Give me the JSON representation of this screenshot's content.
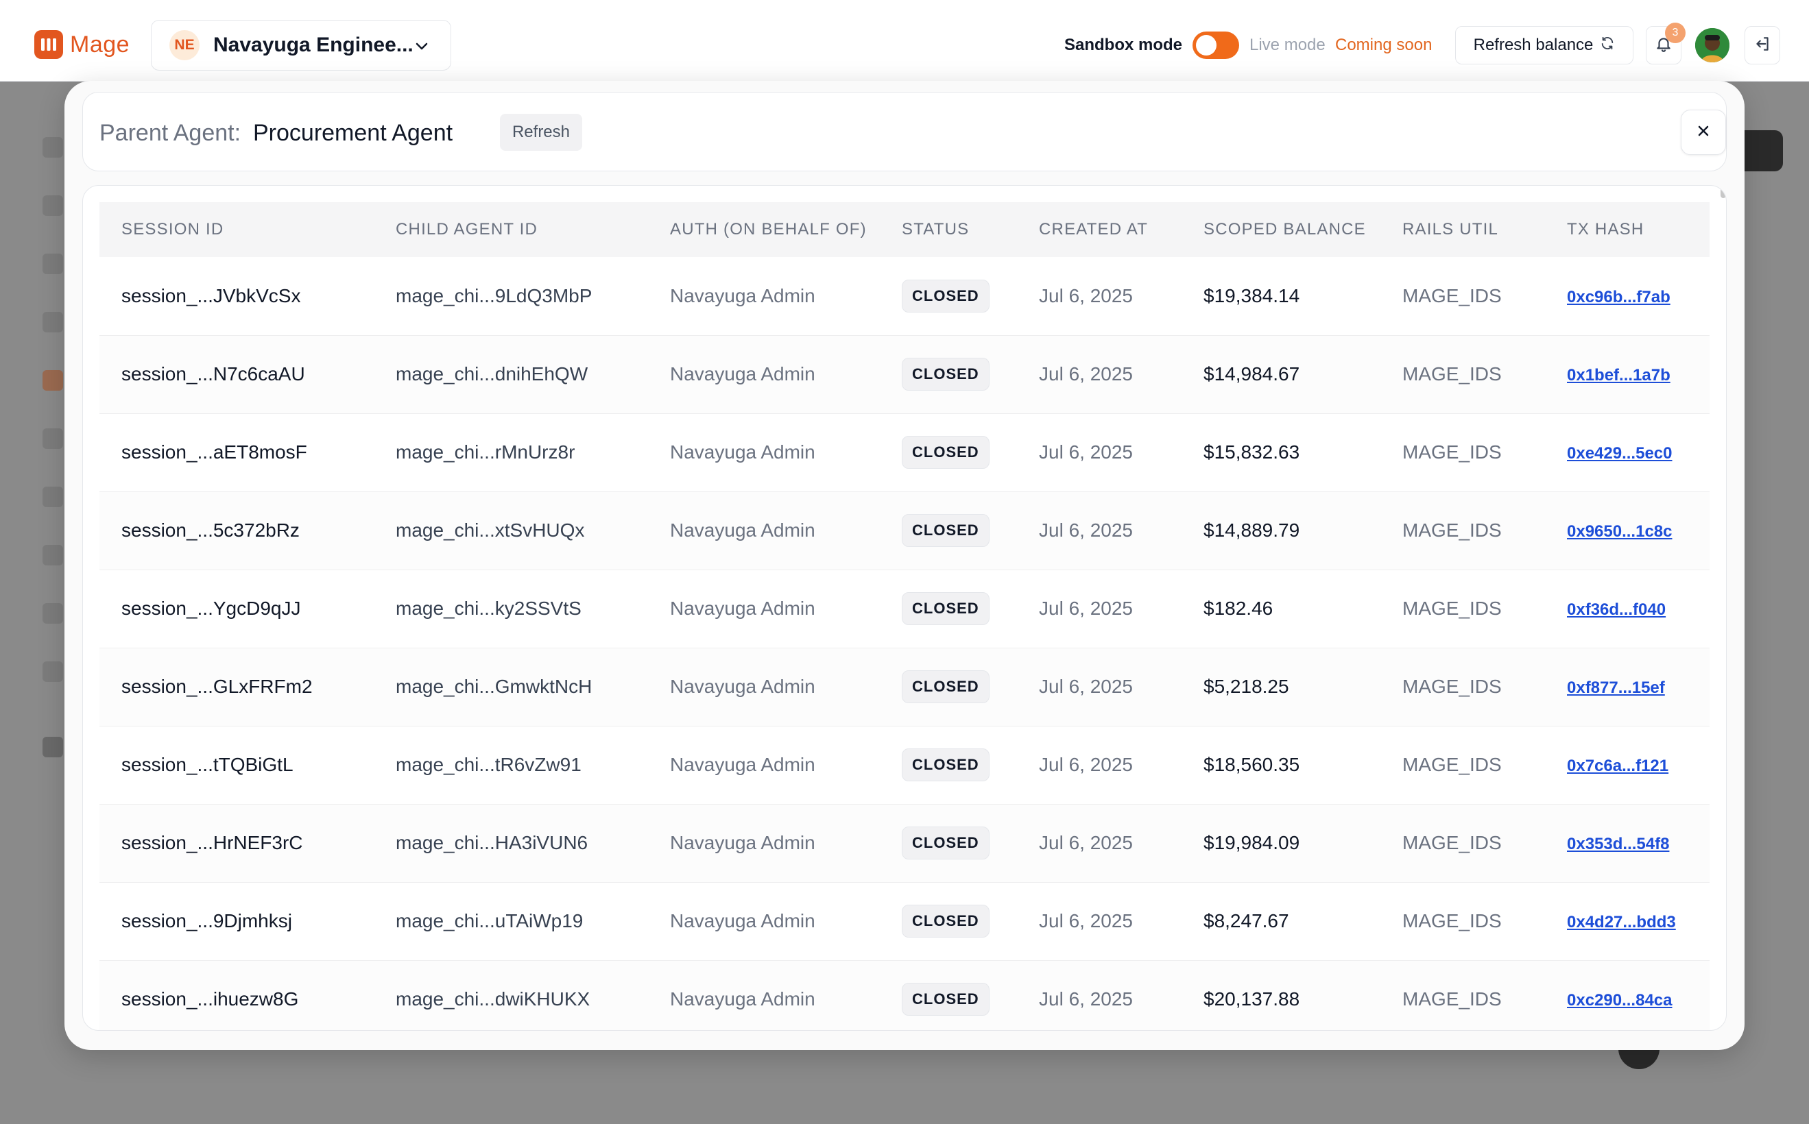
{
  "topbar": {
    "brand": "Mage",
    "org": {
      "initials": "NE",
      "name": "Navayuga Enginee..."
    },
    "sandbox_label": "Sandbox mode",
    "sandbox_on": true,
    "live_label": "Live mode",
    "coming_soon": "Coming soon",
    "refresh_balance": "Refresh balance",
    "notification_count": "3"
  },
  "modal": {
    "parent_label": "Parent Agent:",
    "parent_name": "Procurement Agent",
    "refresh_label": "Refresh",
    "columns": [
      "SESSION ID",
      "CHILD AGENT ID",
      "AUTH (ON BEHALF OF)",
      "STATUS",
      "CREATED AT",
      "SCOPED BALANCE",
      "RAILS UTIL",
      "TX HASH"
    ],
    "rows": [
      {
        "session": "session_...JVbkVcSx",
        "child": "mage_chi...9LdQ3MbP",
        "auth": "Navayuga Admin",
        "status": "CLOSED",
        "created": "Jul 6, 2025",
        "balance": "$19,384.14",
        "rails": "MAGE_IDS",
        "tx": "0xc96b...f7ab"
      },
      {
        "session": "session_...N7c6caAU",
        "child": "mage_chi...dnihEhQW",
        "auth": "Navayuga Admin",
        "status": "CLOSED",
        "created": "Jul 6, 2025",
        "balance": "$14,984.67",
        "rails": "MAGE_IDS",
        "tx": "0x1bef...1a7b"
      },
      {
        "session": "session_...aET8mosF",
        "child": "mage_chi...rMnUrz8r",
        "auth": "Navayuga Admin",
        "status": "CLOSED",
        "created": "Jul 6, 2025",
        "balance": "$15,832.63",
        "rails": "MAGE_IDS",
        "tx": "0xe429...5ec0"
      },
      {
        "session": "session_...5c372bRz",
        "child": "mage_chi...xtSvHUQx",
        "auth": "Navayuga Admin",
        "status": "CLOSED",
        "created": "Jul 6, 2025",
        "balance": "$14,889.79",
        "rails": "MAGE_IDS",
        "tx": "0x9650...1c8c"
      },
      {
        "session": "session_...YgcD9qJJ",
        "child": "mage_chi...ky2SSVtS",
        "auth": "Navayuga Admin",
        "status": "CLOSED",
        "created": "Jul 6, 2025",
        "balance": "$182.46",
        "rails": "MAGE_IDS",
        "tx": "0xf36d...f040"
      },
      {
        "session": "session_...GLxFRFm2",
        "child": "mage_chi...GmwktNcH",
        "auth": "Navayuga Admin",
        "status": "CLOSED",
        "created": "Jul 6, 2025",
        "balance": "$5,218.25",
        "rails": "MAGE_IDS",
        "tx": "0xf877...15ef"
      },
      {
        "session": "session_...tTQBiGtL",
        "child": "mage_chi...tR6vZw91",
        "auth": "Navayuga Admin",
        "status": "CLOSED",
        "created": "Jul 6, 2025",
        "balance": "$18,560.35",
        "rails": "MAGE_IDS",
        "tx": "0x7c6a...f121"
      },
      {
        "session": "session_...HrNEF3rC",
        "child": "mage_chi...HA3iVUN6",
        "auth": "Navayuga Admin",
        "status": "CLOSED",
        "created": "Jul 6, 2025",
        "balance": "$19,984.09",
        "rails": "MAGE_IDS",
        "tx": "0x353d...54f8"
      },
      {
        "session": "session_...9Djmhksj",
        "child": "mage_chi...uTAiWp19",
        "auth": "Navayuga Admin",
        "status": "CLOSED",
        "created": "Jul 6, 2025",
        "balance": "$8,247.67",
        "rails": "MAGE_IDS",
        "tx": "0x4d27...bdd3"
      },
      {
        "session": "session_...ihuezw8G",
        "child": "mage_chi...dwiKHUKX",
        "auth": "Navayuga Admin",
        "status": "CLOSED",
        "created": "Jul 6, 2025",
        "balance": "$20,137.88",
        "rails": "MAGE_IDS",
        "tx": "0xc290...84ca"
      }
    ]
  },
  "colors": {
    "brand": "#e2561f",
    "toggle_on": "#f06a1a",
    "link": "#1d4ed8",
    "overlay": "#8a8a8a"
  },
  "icons": [
    "mage-logo-icon",
    "chevron-down-icon",
    "refresh-icon",
    "bell-icon",
    "logout-icon",
    "close-icon"
  ]
}
